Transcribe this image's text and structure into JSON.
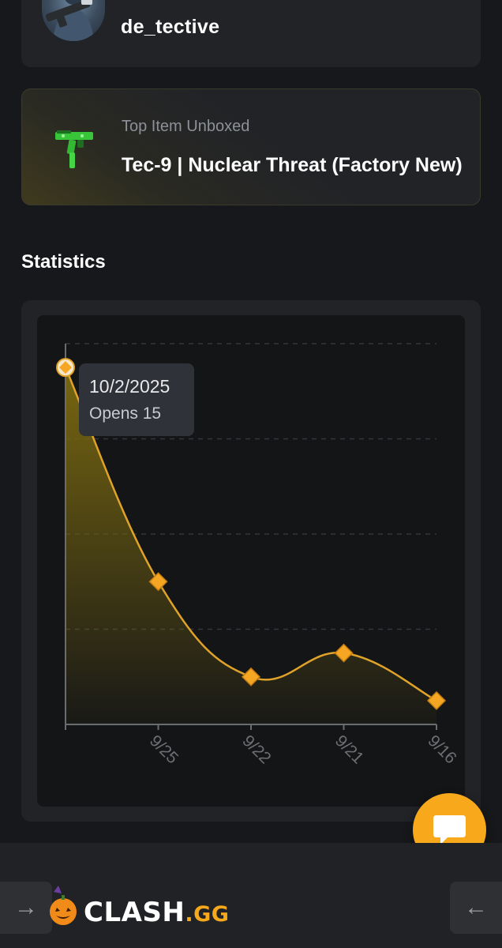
{
  "user": {
    "username": "de_tective"
  },
  "top_item": {
    "caption": "Top Item Unboxed",
    "name": "Tec-9 | Nuclear Threat (Factory New)"
  },
  "statistics": {
    "title": "Statistics",
    "tooltip": {
      "date": "10/2/2025",
      "label": "Opens",
      "value": "15"
    }
  },
  "chart_data": {
    "type": "area",
    "x": [
      "10/2",
      "9/25",
      "9/22",
      "9/21",
      "9/16"
    ],
    "x_tick_labels": [
      "",
      "9/25",
      "9/22",
      "9/21",
      "9/16"
    ],
    "series": [
      {
        "values": [
          15,
          6,
          2,
          3,
          1
        ]
      }
    ],
    "ylim": [
      0,
      16
    ],
    "grid": true,
    "colors": {
      "line": "#e0a32a",
      "fill_top": "#7d6b10",
      "marker": "#f5a623"
    }
  },
  "footer": {
    "brand_main": "CLASH",
    "brand_dot": ".GG",
    "left_arrow_icon": "arrow-right-icon",
    "right_arrow_icon": "arrow-left-icon"
  },
  "colors": {
    "accent": "#f7a81b",
    "background": "#17181b",
    "card": "#212327"
  }
}
